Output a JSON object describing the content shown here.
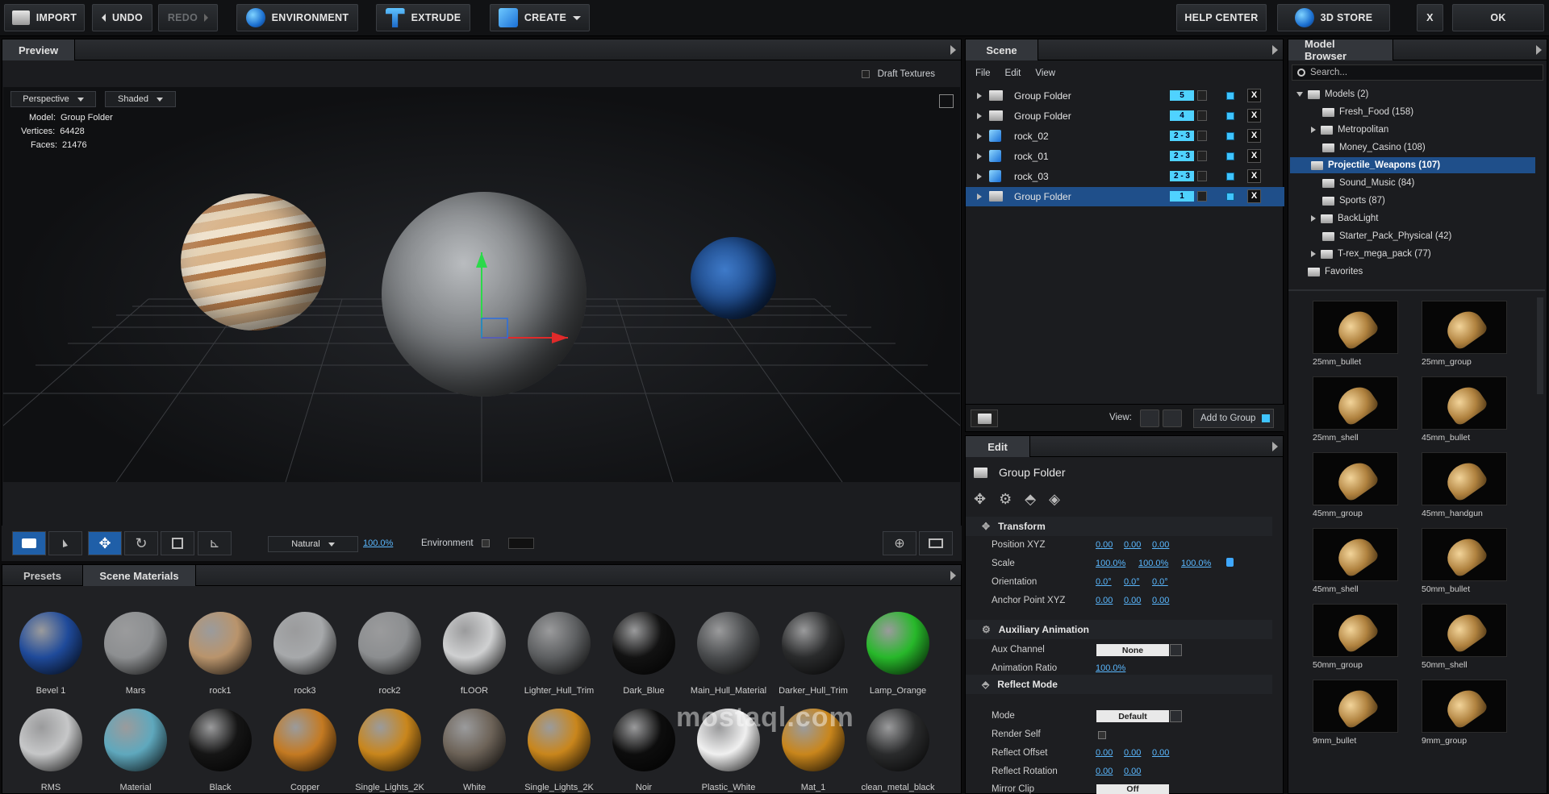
{
  "toolbar": {
    "import": "IMPORT",
    "undo": "UNDO",
    "redo": "REDO",
    "environment": "ENVIRONMENT",
    "extrude": "EXTRUDE",
    "create": "CREATE",
    "help": "HELP CENTER",
    "store": "3D STORE",
    "close": "X",
    "ok": "OK"
  },
  "preview": {
    "tab": "Preview",
    "draft": "Draft Textures",
    "camera": "Perspective",
    "shading": "Shaded",
    "info": {
      "model_label": "Model:",
      "model": "Group Folder",
      "vertices_label": "Vertices:",
      "vertices": "64428",
      "faces_label": "Faces:",
      "faces": "21476"
    },
    "light": "Natural",
    "zoom": "100.0%",
    "environment": "Environment"
  },
  "scene": {
    "tab": "Scene",
    "menu": [
      "File",
      "Edit",
      "View"
    ],
    "rows": [
      {
        "name": "Group Folder",
        "badge": "5",
        "type": "folder"
      },
      {
        "name": "Group Folder",
        "badge": "4",
        "type": "folder"
      },
      {
        "name": "rock_02",
        "badge": "2 - 3",
        "type": "cube"
      },
      {
        "name": "rock_01",
        "badge": "2 - 3",
        "type": "cube"
      },
      {
        "name": "rock_03",
        "badge": "2 - 3",
        "type": "cube"
      },
      {
        "name": "Group Folder",
        "badge": "1",
        "type": "folder",
        "selected": true
      }
    ],
    "x": "X",
    "view_label": "View:",
    "add_group": "Add to Group"
  },
  "edit": {
    "tab": "Edit",
    "title": "Group Folder",
    "transform": "Transform",
    "position": "Position XYZ",
    "scale": "Scale",
    "orientation": "Orientation",
    "anchor": "Anchor Point XYZ",
    "pos_vals": [
      "0.00",
      "0.00",
      "0.00"
    ],
    "scale_vals": [
      "100.0%",
      "100.0%",
      "100.0%"
    ],
    "orient_vals": [
      "0.0°",
      "0.0°",
      "0.0°"
    ],
    "anchor_vals": [
      "0.00",
      "0.00",
      "0.00"
    ],
    "aux": "Auxiliary Animation",
    "aux_channel": "Aux Channel",
    "aux_val": "None",
    "anim_ratio": "Animation Ratio",
    "anim_val": "100.0%",
    "reflect": "Reflect Mode",
    "mode": "Mode",
    "mode_val": "Default",
    "render_self": "Render Self",
    "reflect_offset": "Reflect Offset",
    "ro_vals": [
      "0.00",
      "0.00",
      "0.00"
    ],
    "reflect_rotation": "Reflect Rotation",
    "rr_vals": [
      "0.00",
      "0.00"
    ],
    "mirror_clip": "Mirror Clip",
    "mirror_val": "Off"
  },
  "browser": {
    "tab": "Model Browser",
    "search": "Search...",
    "tree": [
      {
        "label": "Models (2)",
        "level": 0,
        "arrow": "down"
      },
      {
        "label": "Fresh_Food (158)",
        "level": 1
      },
      {
        "label": "Metropolitan",
        "level": 1,
        "arrow": "right"
      },
      {
        "label": "Money_Casino (108)",
        "level": 1
      },
      {
        "label": "Projectile_Weapons (107)",
        "level": 1,
        "selected": true
      },
      {
        "label": "Sound_Music (84)",
        "level": 1
      },
      {
        "label": "Sports (87)",
        "level": 1
      },
      {
        "label": "BackLight",
        "level": 1,
        "arrow": "right"
      },
      {
        "label": "Starter_Pack_Physical (42)",
        "level": 1
      },
      {
        "label": "T-rex_mega_pack (77)",
        "level": 1,
        "arrow": "right"
      },
      {
        "label": "Favorites",
        "level": 0
      }
    ],
    "thumbs": [
      "25mm_bullet",
      "25mm_group",
      "25mm_shell",
      "45mm_bullet",
      "45mm_group",
      "45mm_handgun",
      "45mm_shell",
      "50mm_bullet",
      "50mm_group",
      "50mm_shell",
      "9mm_bullet",
      "9mm_group"
    ]
  },
  "materials": {
    "tabs": [
      "Presets",
      "Scene Materials"
    ],
    "items": [
      "Bevel 1",
      "Mars",
      "rock1",
      "rock3",
      "rock2",
      "fLOOR",
      "Lighter_Hull_Trim",
      "Dark_Blue",
      "Main_Hull_Material",
      "Darker_Hull_Trim",
      "Lamp_Orange",
      "RMS",
      "Material",
      "Black",
      "Copper",
      "Single_Lights_2K",
      "White",
      "Single_Lights_2K",
      "Noir",
      "Plastic_White",
      "Mat_1",
      "clean_metal_black"
    ],
    "colors": [
      "#1f4a9a",
      "#8d8f91",
      "#b9946c",
      "#a7a9ab",
      "#8c8e90",
      "#cfd0d1",
      "#5d5f61",
      "#121212",
      "#4a4c4e",
      "#2a2b2c",
      "#27b82a",
      "#c6c7c8",
      "#5fa8bd",
      "#151515",
      "#c47a22",
      "#c9861c",
      "#6d6358",
      "#c9861c",
      "#0d0d0d",
      "#f0f0f0",
      "#c9861c",
      "#2a2b2c"
    ]
  },
  "watermark": "mostaql.com"
}
